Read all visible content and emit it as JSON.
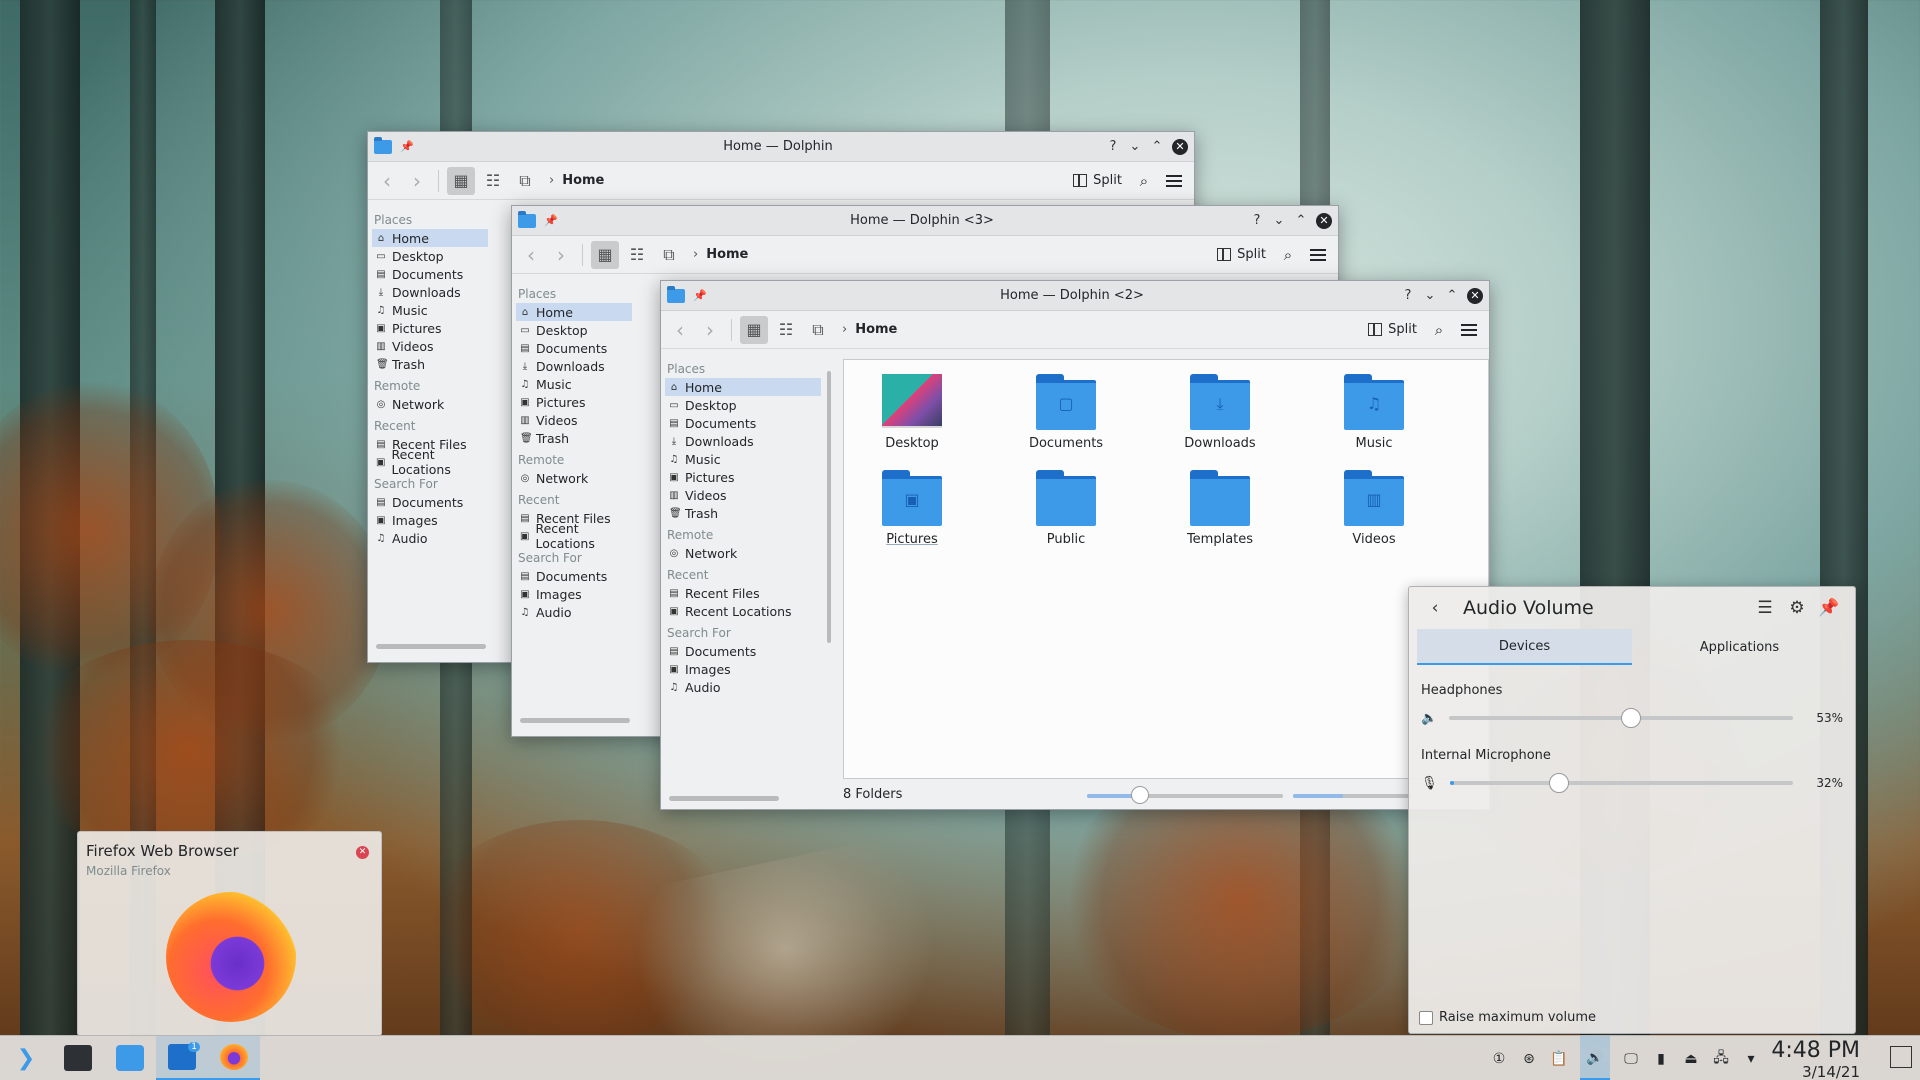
{
  "windows": {
    "dolphin1": {
      "title": "Home — Dolphin",
      "breadcrumb": "Home",
      "split_label": "Split"
    },
    "dolphin3": {
      "title": "Home — Dolphin <3>",
      "breadcrumb": "Home",
      "split_label": "Split"
    },
    "dolphin2": {
      "title": "Home — Dolphin <2>",
      "breadcrumb": "Home",
      "split_label": "Split",
      "status": "8 Folders"
    }
  },
  "places": {
    "section_places": "Places",
    "items": [
      "Home",
      "Desktop",
      "Documents",
      "Downloads",
      "Music",
      "Pictures",
      "Videos",
      "Trash"
    ],
    "section_remote": "Remote",
    "remote": [
      "Network"
    ],
    "section_recent": "Recent",
    "recent": [
      "Recent Files",
      "Recent Locations"
    ],
    "section_search": "Search For",
    "search": [
      "Documents",
      "Images",
      "Audio"
    ]
  },
  "folders": [
    "Desktop",
    "Documents",
    "Downloads",
    "Music",
    "Pictures",
    "Public",
    "Templates",
    "Videos"
  ],
  "audio": {
    "title": "Audio Volume",
    "tab_devices": "Devices",
    "tab_applications": "Applications",
    "devices": [
      {
        "name": "Headphones",
        "percent_label": "53%",
        "level": 0.53
      },
      {
        "name": "Internal Microphone",
        "percent_label": "32%",
        "level": 0.32
      }
    ],
    "raise_max": "Raise maximum volume"
  },
  "notification": {
    "title": "Firefox Web Browser",
    "subtitle": "Mozilla Firefox"
  },
  "taskbar": {
    "badge": "1",
    "time": "4:48 PM",
    "date": "3/14/21"
  },
  "colors": {
    "accent": "#3d9ae8",
    "folder": "#3d9ae8",
    "close_red": "#da4453"
  }
}
